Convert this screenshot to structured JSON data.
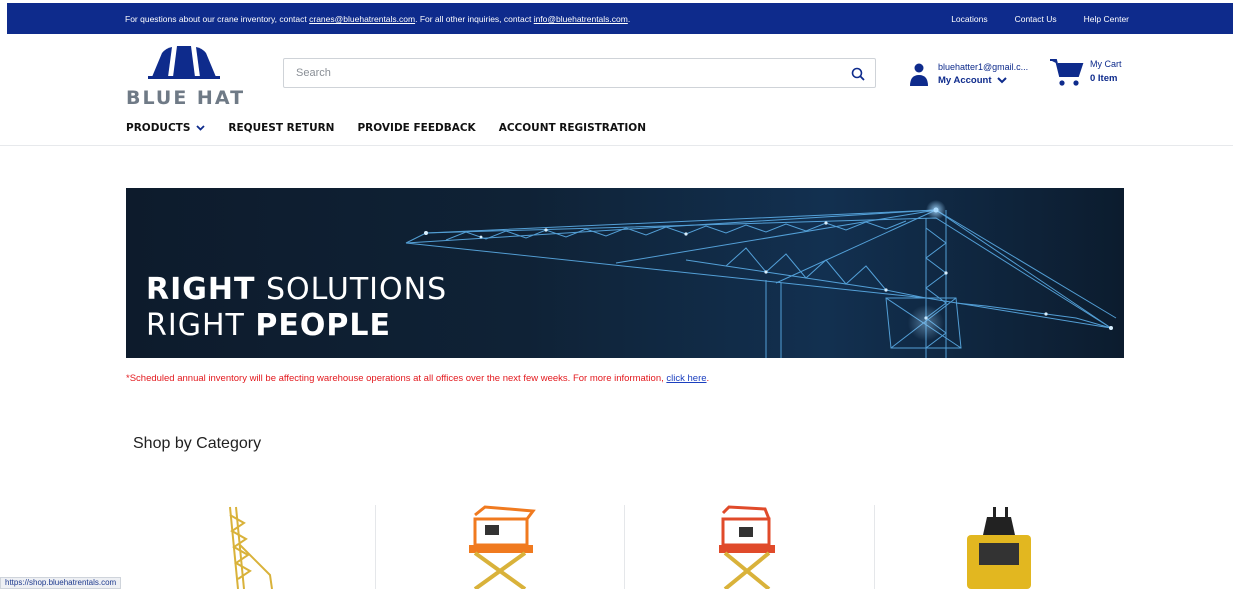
{
  "topbar": {
    "msg_prefix": "For questions about our crane inventory, contact ",
    "crane_email": "cranes@bluehatrentals.com",
    "msg_middle": ". For all other inquiries, contact ",
    "info_email": "info@bluehatrentals.com",
    "msg_suffix": ".",
    "links": [
      "Locations",
      "Contact Us",
      "Help Center"
    ]
  },
  "logo": {
    "wordmark": "BLUE HAT"
  },
  "search": {
    "placeholder": "Search",
    "value": ""
  },
  "account": {
    "email": "bluehatter1@gmail.c...",
    "label": "My Account"
  },
  "cart": {
    "label": "My Cart",
    "count": "0 Item"
  },
  "nav": {
    "items": [
      "PRODUCTS",
      "REQUEST RETURN",
      "PROVIDE FEEDBACK",
      "ACCOUNT REGISTRATION"
    ]
  },
  "banner": {
    "line1_bold": "RIGHT",
    "line1_thin": " SOLUTIONS",
    "line2_thin": "RIGHT ",
    "line2_bold": "PEOPLE"
  },
  "notice": {
    "text": "*Scheduled annual inventory will be affecting warehouse operations at all offices over the next few weeks. For more information, ",
    "link": "click here",
    "suffix": "."
  },
  "shop": {
    "title": "Shop by Category"
  },
  "categories": [
    {
      "icon": "crane-icon"
    },
    {
      "icon": "scissor-lift-icon"
    },
    {
      "icon": "scissor-lift-icon"
    },
    {
      "icon": "compact-loader-icon"
    }
  ],
  "statusbar": {
    "url": "https://shop.bluehatrentals.com"
  },
  "colors": {
    "brand_blue": "#0e2b8c",
    "notice_red": "#e3191e",
    "lift_orange": "#f07a1f"
  }
}
